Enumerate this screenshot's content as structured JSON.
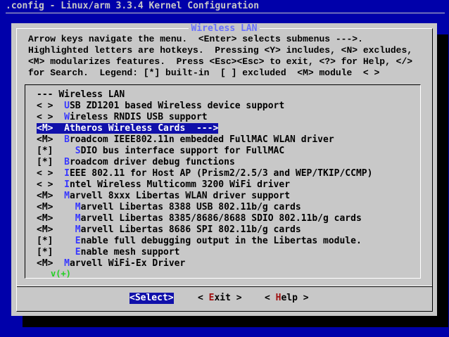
{
  "window": {
    "title": ".config - Linux/arm 3.3.4 Kernel Configuration"
  },
  "dialog": {
    "title": "Wireless LAN",
    "help_lines": [
      "Arrow keys navigate the menu.  <Enter> selects submenus --->.",
      "Highlighted letters are hotkeys.  Pressing <Y> includes, <N> excludes,",
      "<M> modularizes features.  Press <Esc><Esc> to exit, <?> for Help, </>",
      "for Search.  Legend: [*] built-in  [ ] excluded  <M> module  < >"
    ]
  },
  "menu": {
    "selected_index": 2,
    "items": [
      {
        "prefix": "---",
        "indent": "",
        "hot": "",
        "label": "Wireless LAN"
      },
      {
        "prefix": "< >",
        "indent": "",
        "hot": "U",
        "label": "SB ZD1201 based Wireless device support"
      },
      {
        "prefix": "< >",
        "indent": "",
        "hot": "W",
        "label": "ireless RNDIS USB support"
      },
      {
        "prefix": "<M>",
        "indent": "",
        "hot": "A",
        "label": "theros Wireless Cards  --->"
      },
      {
        "prefix": "<M>",
        "indent": "",
        "hot": "B",
        "label": "roadcom IEEE802.11n embedded FullMAC WLAN driver"
      },
      {
        "prefix": "[*]",
        "indent": "  ",
        "hot": "S",
        "label": "DIO bus interface support for FullMAC"
      },
      {
        "prefix": "[*]",
        "indent": "",
        "hot": "B",
        "label": "roadcom driver debug functions"
      },
      {
        "prefix": "< >",
        "indent": "",
        "hot": "I",
        "label": "EEE 802.11 for Host AP (Prism2/2.5/3 and WEP/TKIP/CCMP)"
      },
      {
        "prefix": "< >",
        "indent": "",
        "hot": "I",
        "label": "ntel Wireless Multicomm 3200 WiFi driver"
      },
      {
        "prefix": "<M>",
        "indent": "",
        "hot": "M",
        "label": "arvell 8xxx Libertas WLAN driver support"
      },
      {
        "prefix": "<M>",
        "indent": "  ",
        "hot": "M",
        "label": "arvell Libertas 8388 USB 802.11b/g cards"
      },
      {
        "prefix": "<M>",
        "indent": "  ",
        "hot": "M",
        "label": "arvell Libertas 8385/8686/8688 SDIO 802.11b/g cards"
      },
      {
        "prefix": "<M>",
        "indent": "  ",
        "hot": "M",
        "label": "arvell Libertas 8686 SPI 802.11b/g cards"
      },
      {
        "prefix": "[*]",
        "indent": "  ",
        "hot": "E",
        "label": "nable full debugging output in the Libertas module."
      },
      {
        "prefix": "[*]",
        "indent": "  ",
        "hot": "E",
        "label": "nable mesh support"
      },
      {
        "prefix": "<M>",
        "indent": "",
        "hot": "M",
        "label": "arvell WiFi-Ex Driver"
      }
    ],
    "more_indicator": "v(+)"
  },
  "buttons": {
    "select": {
      "open": "<",
      "hot": "S",
      "rest": "elect",
      "close": ">"
    },
    "exit": {
      "open": "< ",
      "hot": "E",
      "rest": "xit",
      "close": " >"
    },
    "help": {
      "open": "< ",
      "hot": "H",
      "rest": "elp",
      "close": " >"
    }
  },
  "colors": {
    "background": "#0000aa",
    "dialog": "#c8c8c8",
    "highlight": "#1010aa",
    "hotkey": "#3838ff",
    "button_hotkey": "#a01010",
    "more_indicator": "#20d020"
  }
}
